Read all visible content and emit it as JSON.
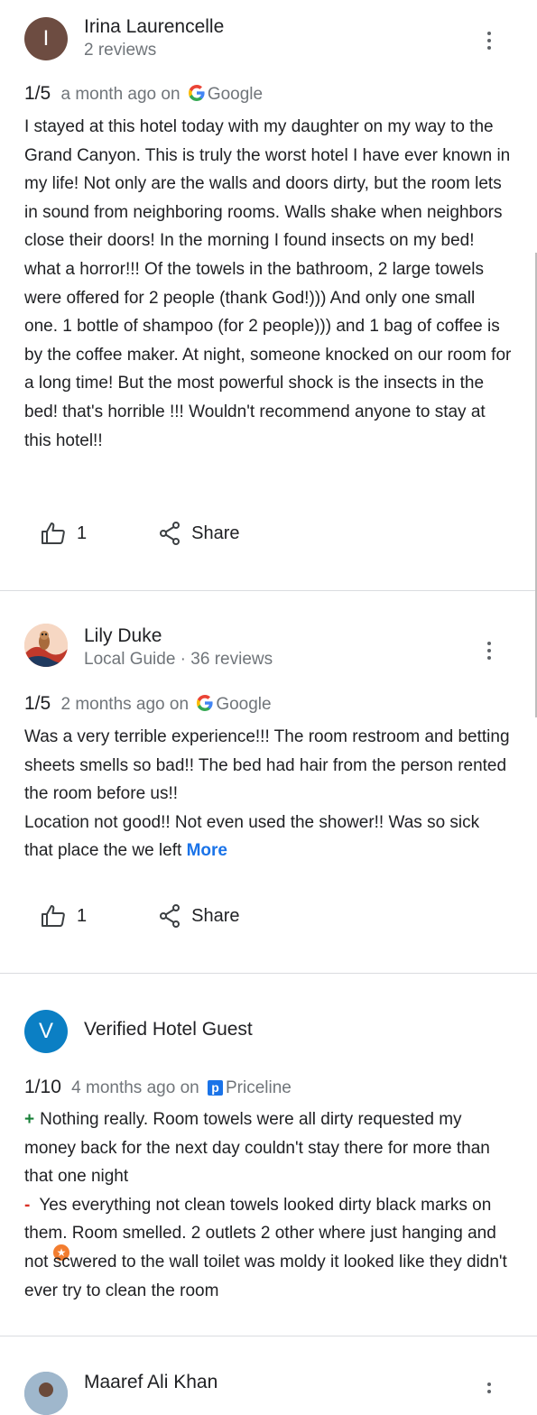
{
  "reviews": [
    {
      "avatar_letter": "I",
      "avatar_color": "#6d4c41",
      "name": "Irina Laurencelle",
      "sub": "2 reviews",
      "score": "1/5",
      "time": "a month ago on",
      "source": "Google",
      "source_icon": "google-g-icon",
      "text": "I stayed at this hotel today with my daughter on my way to the Grand Canyon.  This is truly the worst hotel I have ever known in my life!  Not only are the walls and doors dirty, but the room lets in sound from neighboring rooms.  Walls shake when neighbors close their doors!  In the morning I found insects on my bed!  what a horror!!!  Of the towels in the bathroom, 2 large towels were offered for 2 people (thank God!))) And only one small one.  1 bottle of shampoo (for 2 people))) and 1 bag of coffee is by the coffee maker.  At night, someone knocked on our room for a long time!  But the most powerful shock is the insects in the bed!  that's horrible !!!  Wouldn't recommend anyone to stay at this hotel!!",
      "likes": "1",
      "share_label": "Share"
    },
    {
      "name": "Lily Duke",
      "sub": "Local Guide · 36 reviews",
      "score": "1/5",
      "time": "2 months ago on",
      "source": "Google",
      "source_icon": "google-g-icon",
      "text_line1": "Was a very terrible experience!!! The room restroom and betting sheets smells so bad!! The bed had hair from the person rented the room before us!!",
      "text_line2": "Location not good!! Not even used the shower!! Was so sick that place the we left",
      "more_label": "More",
      "likes": "1",
      "share_label": "Share"
    },
    {
      "avatar_letter": "V",
      "avatar_color": "#0b7fc4",
      "name": "Verified Hotel Guest",
      "score": "1/10",
      "time": "4 months ago on",
      "source": "Priceline",
      "source_icon": "priceline-p-icon",
      "positive_mark": "+",
      "positive": "Nothing really. Room towels were all dirty requested my money back for the next day couldn't stay there for more than that one night",
      "negative_mark": "-",
      "negative": "Yes everything not clean towels looked dirty black marks on them.  Room smelled. 2 outlets 2 other where just hanging and not scwered to the wall toilet was moldy it looked like they didn't ever try to clean the room"
    },
    {
      "name": "Maaref Ali Khan"
    }
  ],
  "colors": {
    "link_blue": "#1a73e8",
    "secondary_text": "#70757a",
    "divider": "#dadce0",
    "positive_green": "#188038",
    "negative_red": "#d93025"
  }
}
